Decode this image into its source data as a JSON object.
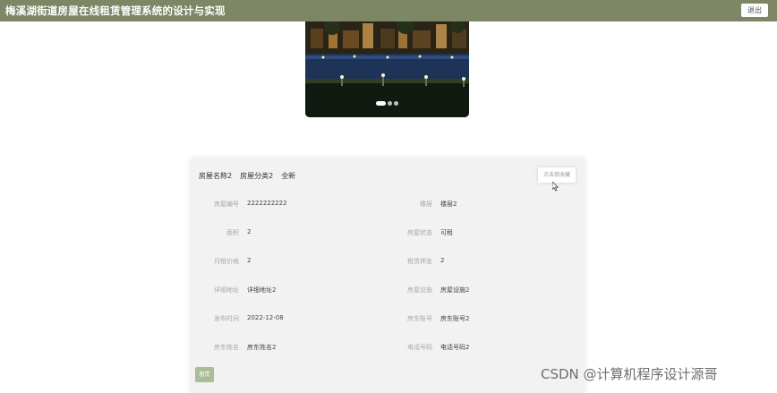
{
  "app": {
    "title": "梅溪湖街道房屋在线租赁管理系统的设计与实现",
    "logout_label": "退出",
    "header_color": "#7d8766"
  },
  "carousel": {
    "image": "night-villa-pool-photo",
    "slides": 3,
    "active_slide": 1
  },
  "detail": {
    "header_items": [
      "房屋名称2",
      "房屋分类2",
      "全新"
    ],
    "favorite_label": "点击我收藏",
    "rent_label": "租赁",
    "fields_left": [
      {
        "label": "房屋编号",
        "value": "2222222222"
      },
      {
        "label": "面积",
        "value": "2"
      },
      {
        "label": "月租价格",
        "value": "2"
      },
      {
        "label": "详细地址",
        "value": "详细地址2"
      },
      {
        "label": "发布时间",
        "value": "2022-12-08"
      },
      {
        "label": "房东姓名",
        "value": "房东姓名2"
      }
    ],
    "fields_right": [
      {
        "label": "楼层",
        "value": "楼层2"
      },
      {
        "label": "房屋状态",
        "value": "可租"
      },
      {
        "label": "租赁押金",
        "value": "2"
      },
      {
        "label": "房屋设施",
        "value": "房屋设施2"
      },
      {
        "label": "房东账号",
        "value": "房东账号2"
      },
      {
        "label": "电话号码",
        "value": "电话号码2"
      }
    ]
  },
  "watermark": "CSDN @计算机程序设计源哥"
}
